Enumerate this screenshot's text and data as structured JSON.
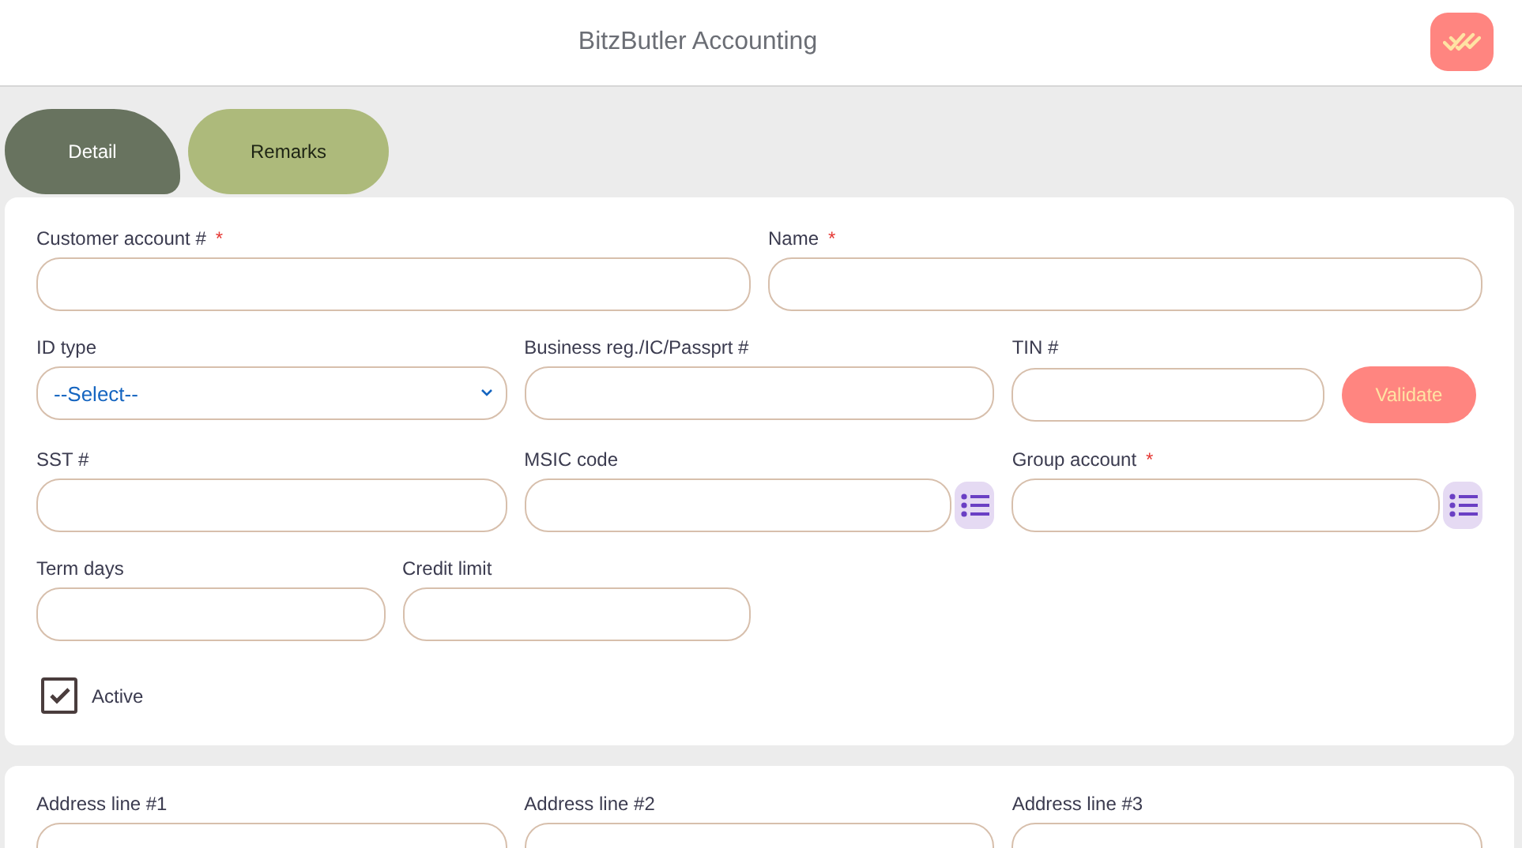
{
  "header": {
    "title": "BitzButler Accounting"
  },
  "tabs": [
    {
      "label": "Detail",
      "selected": true
    },
    {
      "label": "Remarks",
      "selected": false
    }
  ],
  "main_form": {
    "rows": [
      [
        {
          "label": "Customer account #",
          "required_mark": "*",
          "kind": "text"
        },
        {
          "label": "Name",
          "required_mark": "*",
          "kind": "text"
        }
      ],
      [
        {
          "label": "ID type",
          "kind": "select",
          "value": "--Select--"
        },
        {
          "label": "Business reg./IC/Passprt #",
          "kind": "text"
        },
        {
          "label": "TIN #",
          "kind": "validate",
          "button": "Validate"
        }
      ],
      [
        {
          "label": "SST #",
          "kind": "text"
        },
        {
          "label": "MSIC code",
          "kind": "lookup"
        },
        {
          "label": "Group account",
          "required_mark": "*",
          "kind": "lookup"
        }
      ],
      [
        {
          "label": "Term days",
          "kind": "text"
        },
        {
          "label": "Credit limit",
          "kind": "text"
        }
      ]
    ],
    "active": {
      "label": "Active",
      "checked": true
    }
  },
  "address_form": {
    "fields": [
      {
        "label": "Address line #1",
        "kind": "text"
      },
      {
        "label": "Address line #2",
        "kind": "text"
      },
      {
        "label": "Address line #3",
        "kind": "text"
      }
    ]
  }
}
